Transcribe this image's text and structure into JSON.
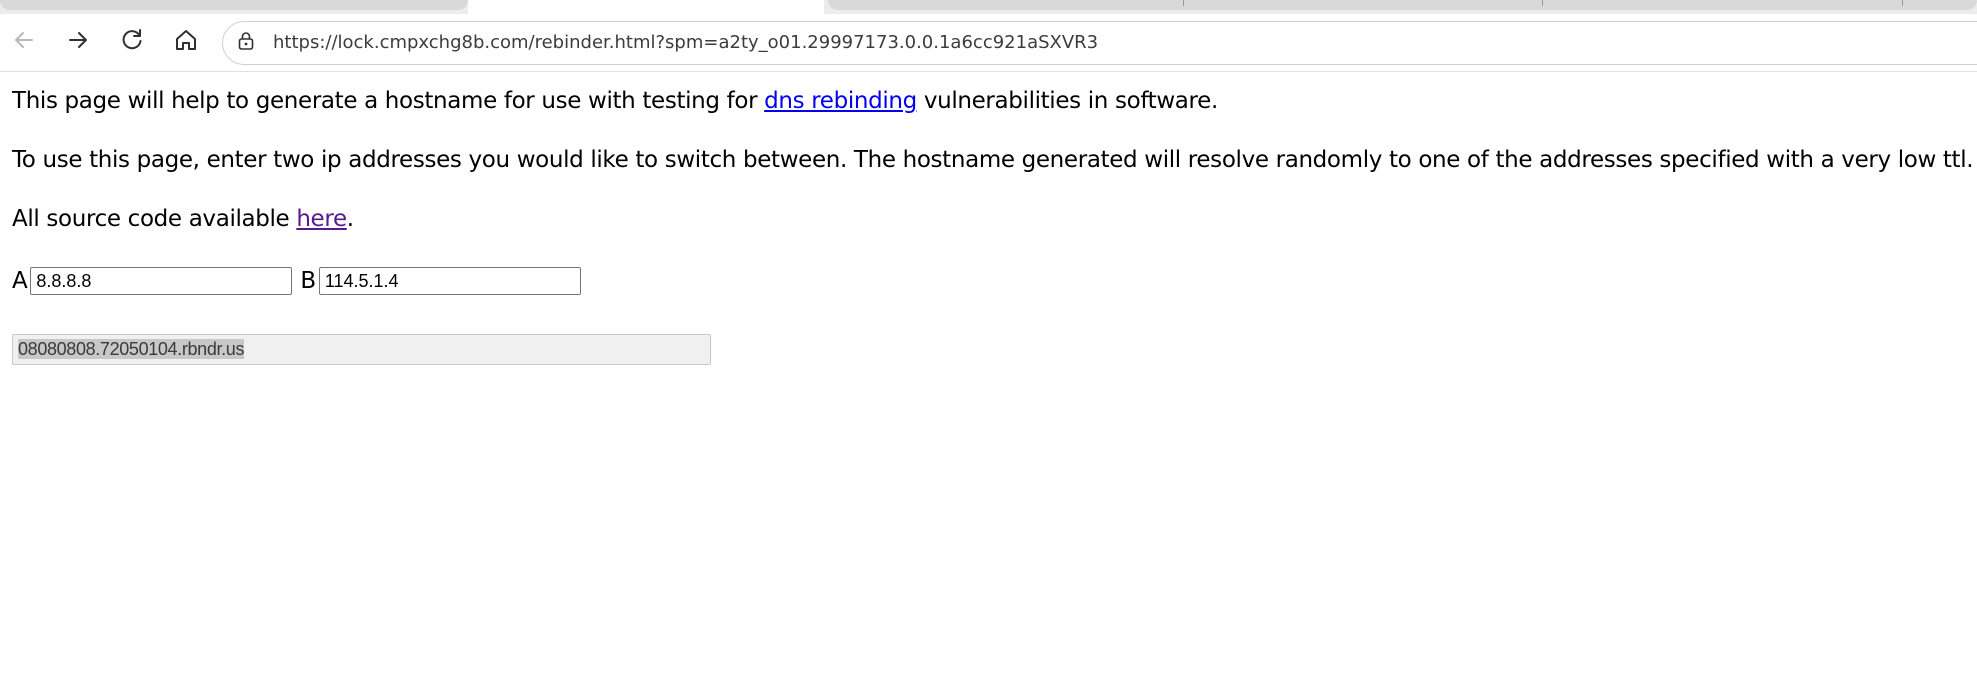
{
  "browser": {
    "url": "https://lock.cmpxchg8b.com/rebinder.html?spm=a2ty_o01.29997173.0.0.1a6cc921aSXVR3",
    "icons": [
      "back-arrow-icon",
      "forward-arrow-icon",
      "reload-icon",
      "home-icon",
      "site-info-icon"
    ]
  },
  "page": {
    "p1_before": "This page will help to generate a hostname for use with testing for ",
    "p1_link": "dns rebinding",
    "p1_after": " vulnerabilities in software.",
    "p2": "To use this page, enter two ip addresses you would like to switch between. The hostname generated will resolve randomly to one of the addresses specified with a very low ttl.",
    "p3_before": "All source code available ",
    "p3_link": "here",
    "p3_after": ".",
    "label_a": "A",
    "value_a": "8.8.8.8",
    "label_b": "B",
    "value_b": "114.5.1.4",
    "hostname": "08080808.72050104.rbndr.us"
  },
  "colors": {
    "link": "#0000ee",
    "visited_link": "#551a8b",
    "selection": "#c8c8c8"
  }
}
